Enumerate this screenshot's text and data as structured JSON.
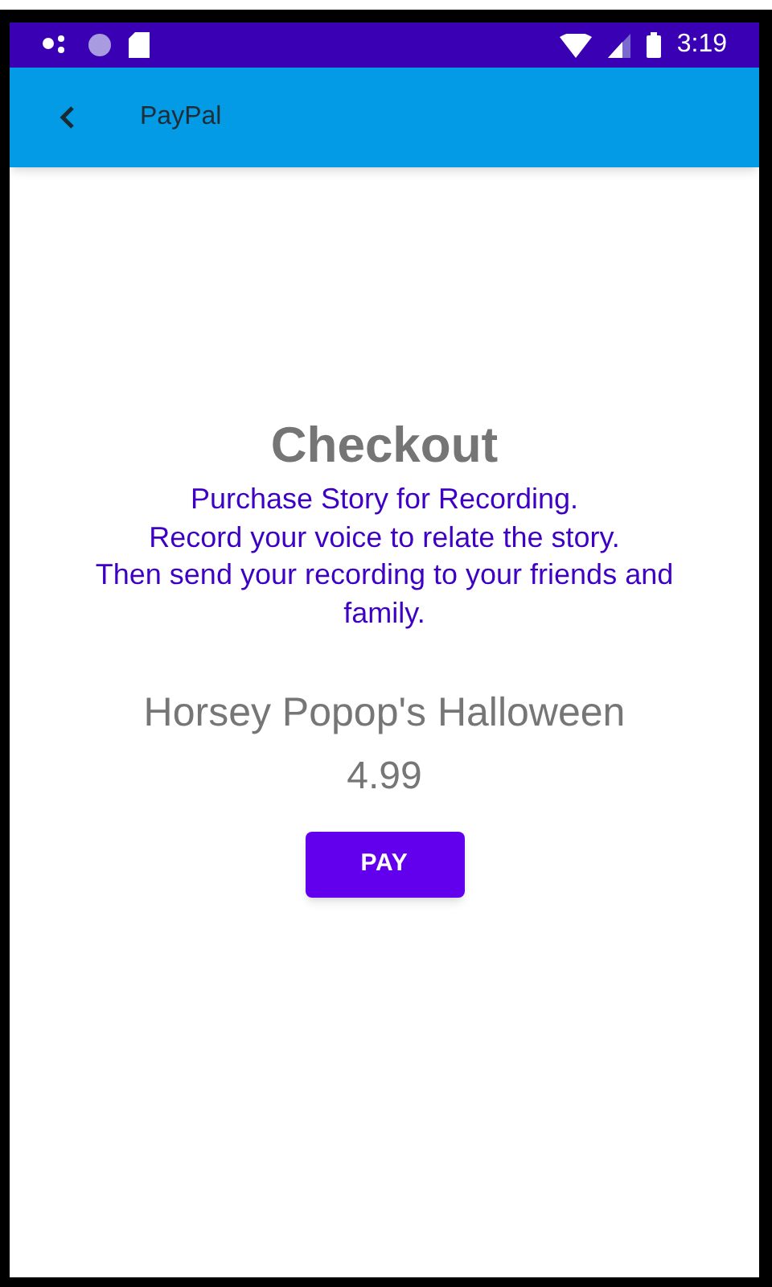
{
  "status_bar": {
    "time": "3:19"
  },
  "app_bar": {
    "title": "PayPal"
  },
  "checkout": {
    "title": "Checkout",
    "description": "Purchase Story for Recording.\nRecord your voice to relate the story.\nThen send your recording to your friends and family.",
    "product": "Horsey Popop's Halloween",
    "price": "4.99",
    "button": "PAY"
  }
}
